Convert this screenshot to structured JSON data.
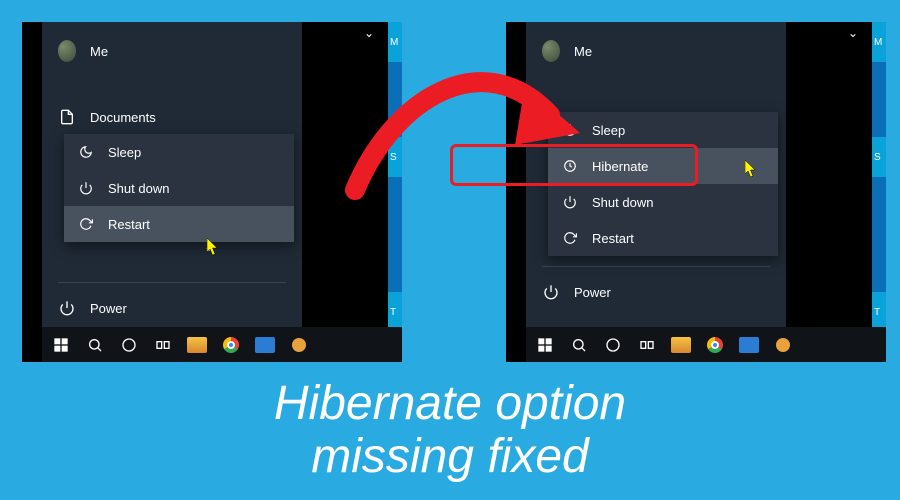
{
  "user": {
    "name": "Me"
  },
  "left_panel": {
    "items": [
      {
        "label": "Documents"
      }
    ],
    "submenu": [
      {
        "label": "Sleep"
      },
      {
        "label": "Shut down"
      },
      {
        "label": "Restart"
      }
    ],
    "power": "Power"
  },
  "right_panel": {
    "submenu": [
      {
        "label": "Sleep"
      },
      {
        "label": "Hibernate"
      },
      {
        "label": "Shut down"
      },
      {
        "label": "Restart"
      }
    ],
    "power": "Power"
  },
  "tiles": {
    "t1": "M",
    "t2": "S",
    "t3": "T"
  },
  "caption_line1": "Hibernate option",
  "caption_line2": "missing fixed",
  "colors": {
    "accent": "#29abe2",
    "highlight": "#ec1c24"
  }
}
